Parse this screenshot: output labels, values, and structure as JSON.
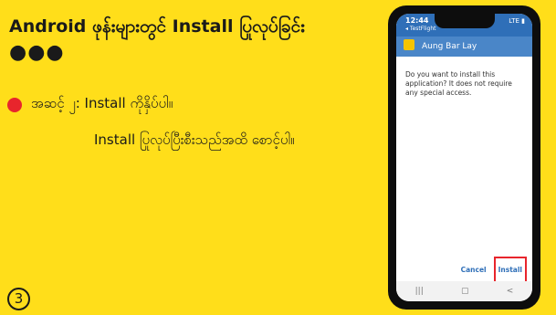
{
  "slide": {
    "title": "Android ဖုန်းများတွင် Install ပြုလုပ်ခြင်း",
    "dots": "●●●",
    "step_line": "အဆင့် ၂: Install ကိုနှိပ်ပါ။",
    "step_detail": "Install ပြုလုပ်ပြီးစီးသည်အထိ စောင့်ပါ။",
    "page_number": "3"
  },
  "phone": {
    "status_time": "12:44",
    "status_back": "◂ TestFlight",
    "status_right": "LTE ▮",
    "app_name": "Aung Bar Lay",
    "dialog_message": "Do you want to install this application? It does not require any special access.",
    "cancel_label": "Cancel",
    "install_label": "Install",
    "nav_recent": "|||",
    "nav_home": "▢",
    "nav_back": "<"
  },
  "colors": {
    "background": "#ffde1a",
    "bullet": "#e8252c",
    "app_header": "#4a86c8",
    "highlight": "#e8252c"
  }
}
